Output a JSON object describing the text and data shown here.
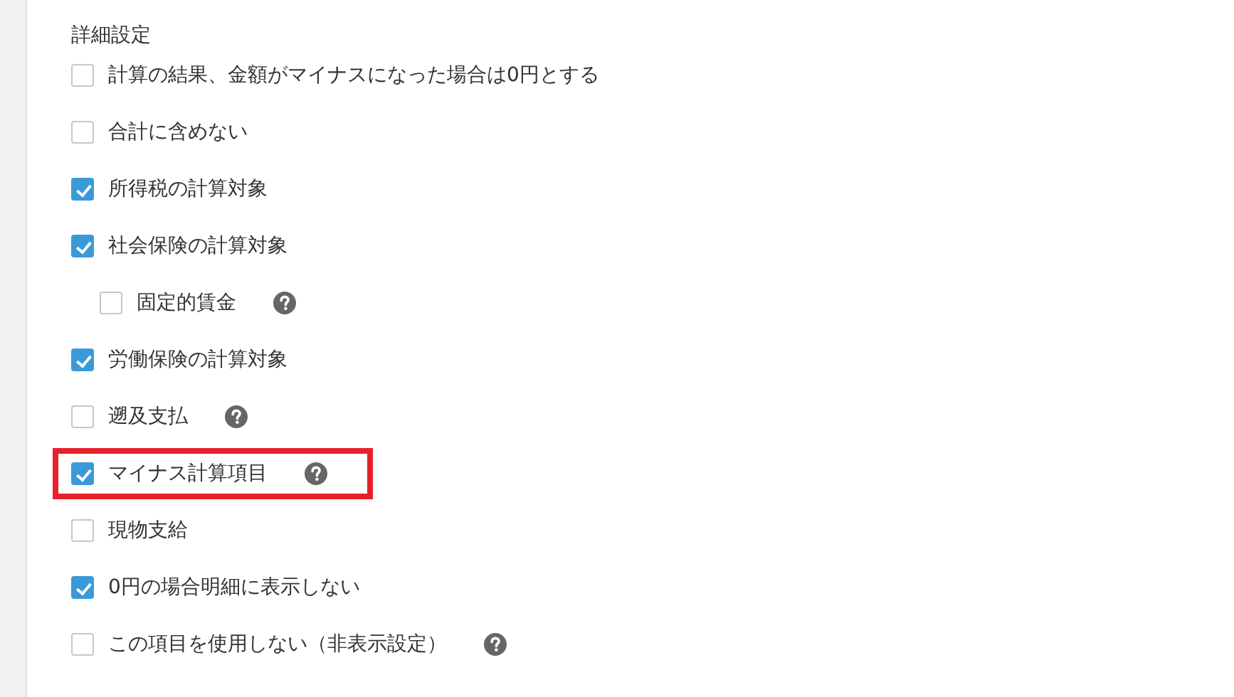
{
  "section_title": "詳細設定",
  "items": [
    {
      "label": "計算の結果、金額がマイナスになった場合は0円とする",
      "checked": false,
      "help": false,
      "highlighted": false
    },
    {
      "label": "合計に含めない",
      "checked": false,
      "help": false,
      "highlighted": false
    },
    {
      "label": "所得税の計算対象",
      "checked": true,
      "help": false,
      "highlighted": false
    },
    {
      "label": "社会保険の計算対象",
      "checked": true,
      "help": false,
      "highlighted": false,
      "children": [
        {
          "label": "固定的賃金",
          "checked": false,
          "help": true,
          "highlighted": false
        }
      ]
    },
    {
      "label": "労働保険の計算対象",
      "checked": true,
      "help": false,
      "highlighted": false
    },
    {
      "label": "遡及支払",
      "checked": false,
      "help": true,
      "highlighted": false
    },
    {
      "label": "マイナス計算項目",
      "checked": true,
      "help": true,
      "highlighted": true
    },
    {
      "label": "現物支給",
      "checked": false,
      "help": false,
      "highlighted": false
    },
    {
      "label": "0円の場合明細に表示しない",
      "checked": true,
      "help": false,
      "highlighted": false
    },
    {
      "label": "この項目を使用しない（非表示設定）",
      "checked": false,
      "help": true,
      "highlighted": false
    }
  ]
}
